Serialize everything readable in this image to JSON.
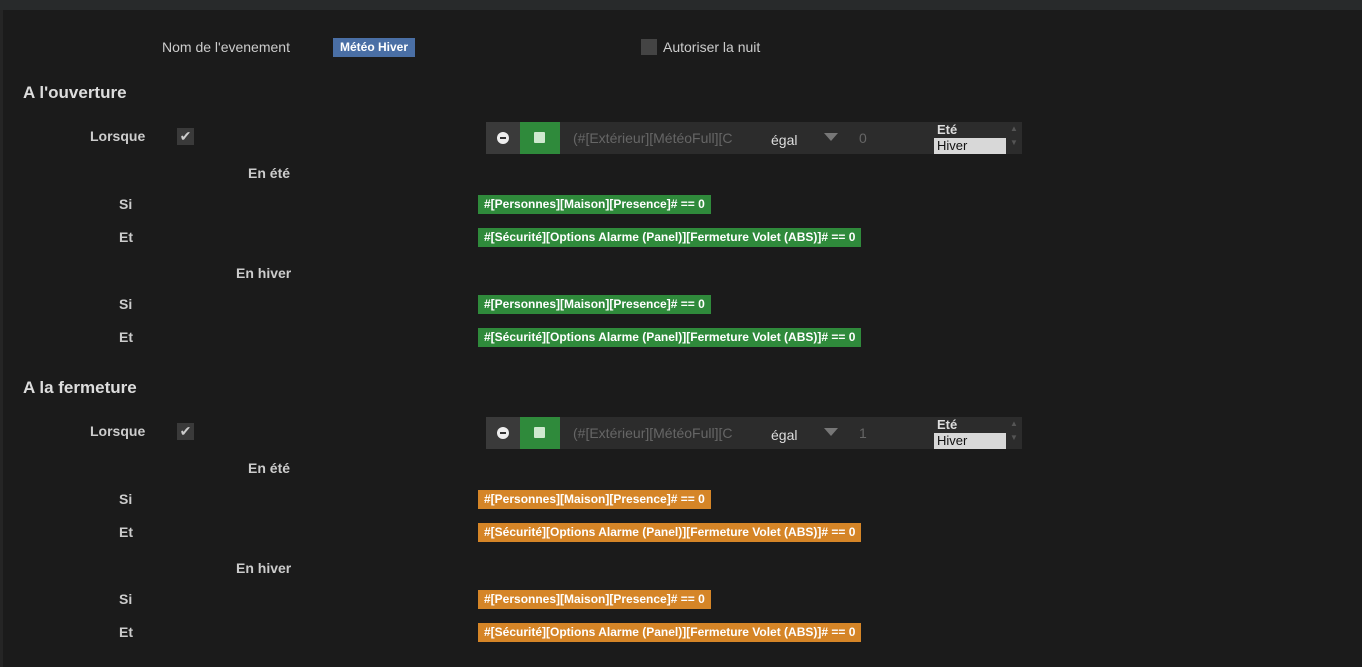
{
  "header": {
    "event_label": "Nom de l'evenement",
    "event_name": "Météo Hiver",
    "night_label": "Autoriser la nuit"
  },
  "sections": [
    {
      "title": "A l'ouverture",
      "when_label": "Lorsque",
      "condition": {
        "expression": "(#[Extérieur][MétéoFull][C",
        "operator": "égal",
        "value": "0",
        "options": [
          "Eté",
          "Hiver"
        ],
        "selected": "Hiver"
      },
      "summer": {
        "title": "En été",
        "rows": [
          {
            "label": "Si",
            "expr": "#[Personnes][Maison][Presence]# == 0"
          },
          {
            "label": "Et",
            "expr": "#[Sécurité][Options Alarme (Panel)][Fermeture Volet (ABS)]# == 0"
          }
        ]
      },
      "winter": {
        "title": "En hiver",
        "rows": [
          {
            "label": "Si",
            "expr": "#[Personnes][Maison][Presence]# == 0"
          },
          {
            "label": "Et",
            "expr": "#[Sécurité][Options Alarme (Panel)][Fermeture Volet (ABS)]# == 0"
          }
        ]
      },
      "color": "#2f8a3b"
    },
    {
      "title": "A la fermeture",
      "when_label": "Lorsque",
      "condition": {
        "expression": "(#[Extérieur][MétéoFull][C",
        "operator": "égal",
        "value": "1",
        "options": [
          "Eté",
          "Hiver"
        ],
        "selected": "Hiver"
      },
      "summer": {
        "title": "En été",
        "rows": [
          {
            "label": "Si",
            "expr": "#[Personnes][Maison][Presence]# == 0"
          },
          {
            "label": "Et",
            "expr": "#[Sécurité][Options Alarme (Panel)][Fermeture Volet (ABS)]# == 0"
          }
        ]
      },
      "winter": {
        "title": "En hiver",
        "rows": [
          {
            "label": "Si",
            "expr": "#[Personnes][Maison][Presence]# == 0"
          },
          {
            "label": "Et",
            "expr": "#[Sécurité][Options Alarme (Panel)][Fermeture Volet (ABS)]# == 0"
          }
        ]
      },
      "color": "#d58527"
    }
  ]
}
